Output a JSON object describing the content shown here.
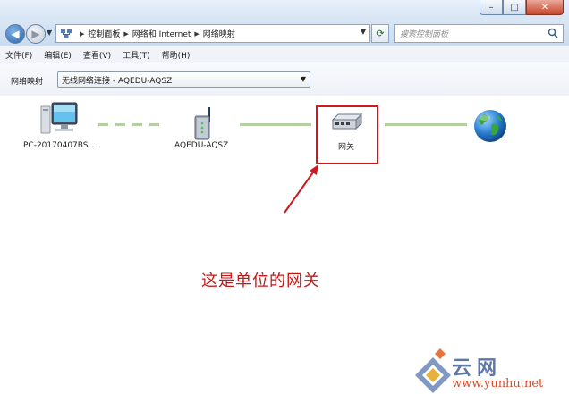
{
  "window": {
    "minimize_glyph": "–",
    "maximize_glyph": "□",
    "close_glyph": "✕"
  },
  "nav": {
    "breadcrumbs": [
      "控制面板",
      "网络和 Internet",
      "网络映射"
    ],
    "search_placeholder": "搜索控制面板"
  },
  "menu": [
    "文件(F)",
    "编辑(E)",
    "查看(V)",
    "工具(T)",
    "帮助(H)"
  ],
  "map_selector": {
    "label": "网络映射",
    "selected": "无线网络连接 - AQEDU-AQSZ"
  },
  "nodes": [
    {
      "label": "PC-20170407BS...",
      "icon": "computer-icon"
    },
    {
      "label": "AQEDU-AQSZ",
      "icon": "wireless-router-icon"
    },
    {
      "label": "网关",
      "icon": "gateway-icon"
    },
    {
      "label": "",
      "icon": "internet-globe-icon"
    }
  ],
  "annotation": "这是单位的网关",
  "watermark": {
    "text": "云网",
    "url": "www.yunhu.net"
  },
  "colors": {
    "highlight": "#d2161e",
    "link": "#b4d0a3"
  }
}
